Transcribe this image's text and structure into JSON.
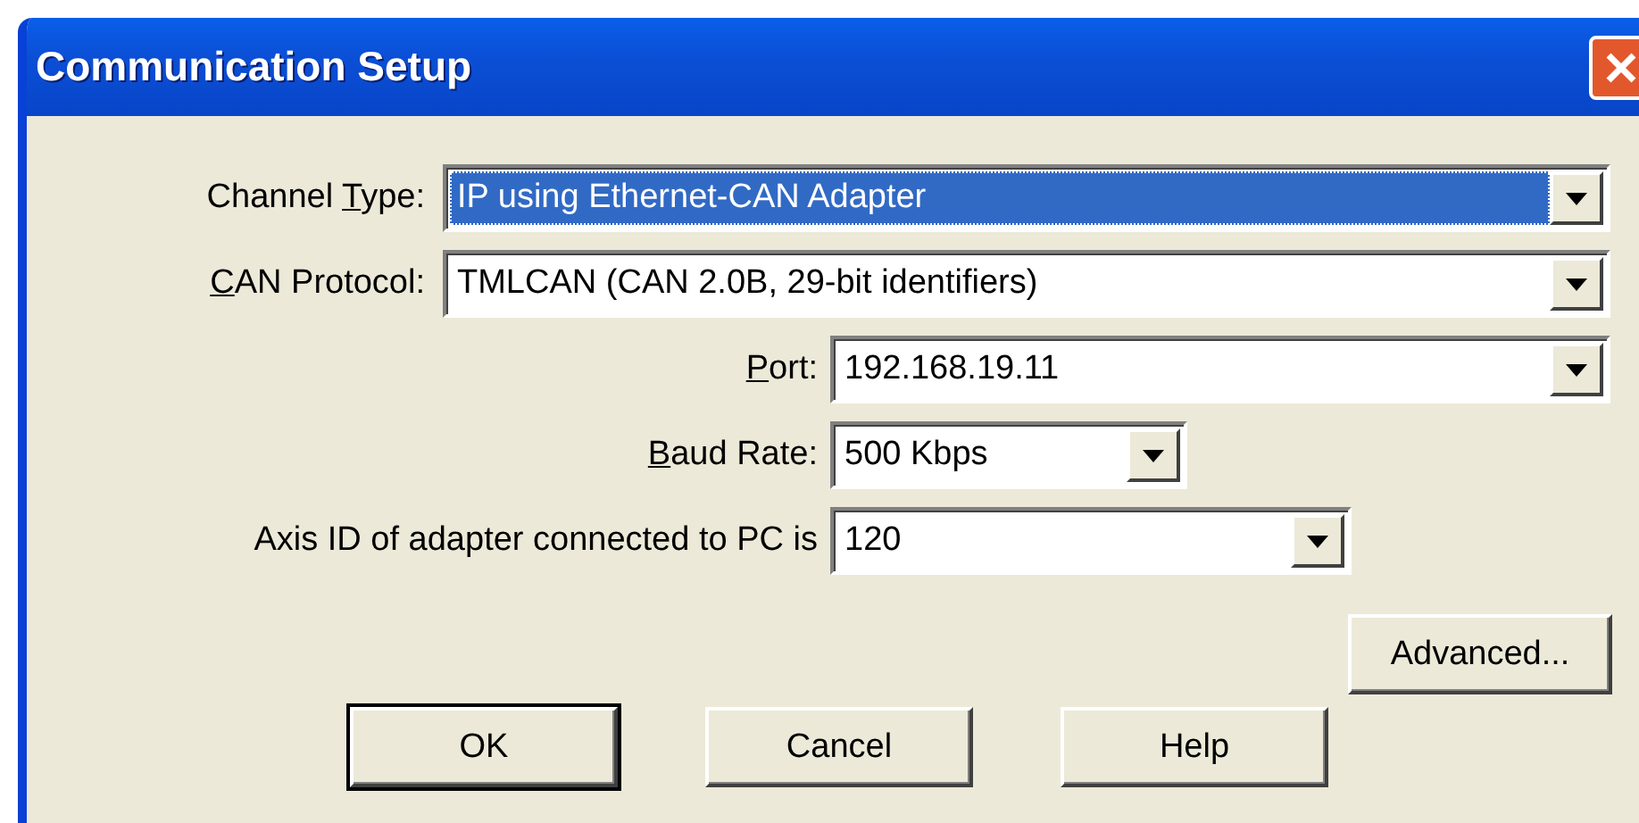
{
  "window": {
    "title": "Communication Setup"
  },
  "fields": [
    {
      "label": {
        "before": "Channel ",
        "key": "T",
        "after": "ype:"
      },
      "value": "IP using Ethernet-CAN Adapter",
      "focused": true
    },
    {
      "label": {
        "key": "C",
        "after": "AN Protocol:"
      },
      "value": "TMLCAN (CAN 2.0B, 29-bit identifiers)",
      "focused": false
    },
    {
      "label": {
        "key": "P",
        "after": "ort:"
      },
      "value": "192.168.19.11",
      "focused": false
    },
    {
      "label": {
        "key": "B",
        "after": "aud Rate:"
      },
      "value": "500 Kbps",
      "focused": false
    },
    {
      "label": {
        "before": "Axis ID of adapter connected to PC is"
      },
      "value": "120",
      "focused": false
    }
  ],
  "advanced_button": {
    "label": "Advanced...",
    "default": false
  },
  "buttons": [
    {
      "label": "OK",
      "default": true
    },
    {
      "label": "Cancel",
      "default": false
    },
    {
      "label": "Help",
      "default": false
    }
  ]
}
